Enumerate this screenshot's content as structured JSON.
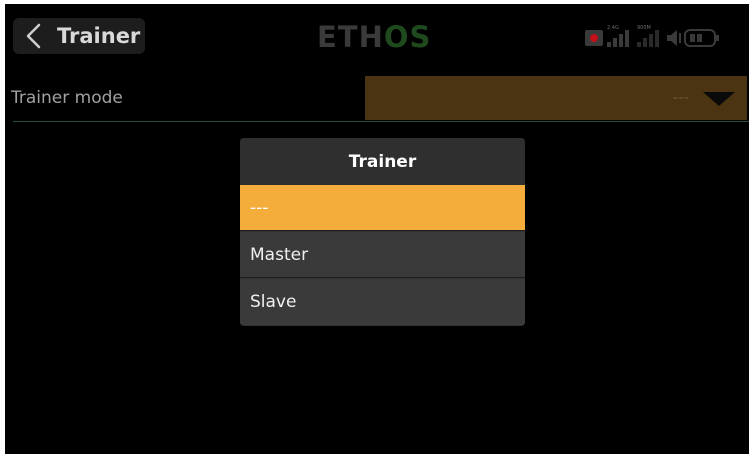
{
  "header": {
    "title": "Trainer",
    "logo_main": "ETH",
    "logo_accent": "OS",
    "status": {
      "band_2_4": "2.4G",
      "band_900": "900M"
    }
  },
  "trainer_mode": {
    "label": "Trainer mode",
    "value": "---"
  },
  "popup": {
    "title": "Trainer",
    "options": [
      {
        "label": "---",
        "selected": true
      },
      {
        "label": "Master",
        "selected": false
      },
      {
        "label": "Slave",
        "selected": false
      }
    ]
  },
  "colors": {
    "accent": "#f4ac3a",
    "select_bg": "#4a3412",
    "logo_accent": "#1e4a1e"
  }
}
